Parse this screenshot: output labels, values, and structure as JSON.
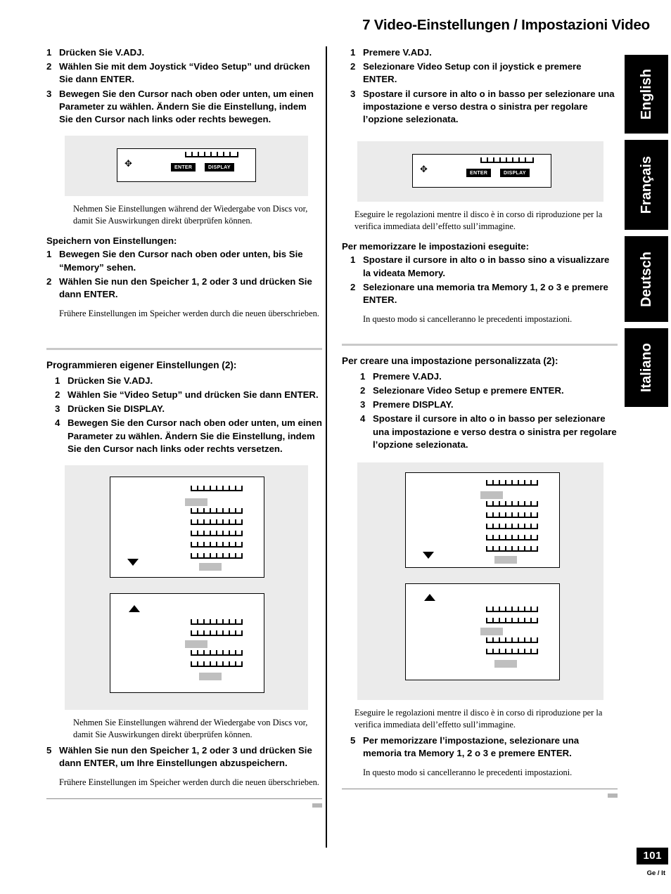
{
  "header": {
    "title": "7 Video-Einstellungen / Impostazioni Video"
  },
  "language_tabs": [
    {
      "label": "English"
    },
    {
      "label": "Français"
    },
    {
      "label": "Deutsch"
    },
    {
      "label": "Italiano"
    }
  ],
  "left_column": {
    "steps_top": [
      {
        "num": "1",
        "text": "Drücken Sie V.ADJ."
      },
      {
        "num": "2",
        "text": "Wählen Sie mit dem Joystick “Video Setup” und drücken Sie dann ENTER."
      },
      {
        "num": "3",
        "text": "Bewegen Sie den Cursor nach oben oder unten, um einen Parameter zu wählen. Ändern Sie die Einstellung, indem Sie den Cursor nach links oder rechts bewegen."
      }
    ],
    "figure_remote": {
      "dpad": "✥",
      "enter_label": "ENTER",
      "display_label": "DISPLAY"
    },
    "note_1": "Nehmen Sie Einstellungen während der Wiedergabe von Discs vor, damit Sie Auswirkungen direkt überprüfen können.",
    "subhead_memory": "Speichern von Einstellungen:",
    "steps_memory": [
      {
        "num": "1",
        "text": "Bewegen Sie den Cursor nach oben oder unten, bis Sie “Memory” sehen."
      },
      {
        "num": "2",
        "text": "Wählen Sie nun den Speicher 1, 2 oder 3 und drücken Sie dann ENTER."
      }
    ],
    "note_2": "Frühere Einstellungen im Speicher werden durch die neuen überschrieben.",
    "section_head": "Programmieren eigener Einstellungen (2):",
    "steps_custom": [
      {
        "num": "1",
        "text": "Drücken Sie V.ADJ."
      },
      {
        "num": "2",
        "text": "Wählen Sie “Video Setup” und drücken Sie dann ENTER."
      },
      {
        "num": "3",
        "text": "Drücken Sie DISPLAY."
      },
      {
        "num": "4",
        "text": "Bewegen Sie den Cursor nach oben oder unten, um einen Parameter zu wählen. Ändern Sie die Einstellung, indem Sie den Cursor nach links oder rechts versetzen."
      }
    ],
    "note_3": "Nehmen Sie Einstellungen während der Wiedergabe von Discs vor, damit Sie Auswirkungen direkt überprüfen können.",
    "step_5": {
      "num": "5",
      "text": "Wählen Sie nun den Speicher 1, 2 oder 3 und drücken Sie dann ENTER, um Ihre Einstellungen abzuspeichern."
    },
    "note_4": "Frühere Einstellungen im Speicher werden durch die neuen überschrieben."
  },
  "right_column": {
    "steps_top": [
      {
        "num": "1",
        "text": "Premere V.ADJ."
      },
      {
        "num": "2",
        "text": "Selezionare Video Setup con il joystick e premere ENTER."
      },
      {
        "num": "3",
        "text": "Spostare il cursore in alto o in basso per selezionare una impostazione e verso destra o sinistra per regolare l’opzione selezionata."
      }
    ],
    "figure_remote": {
      "dpad": "✥",
      "enter_label": "ENTER",
      "display_label": "DISPLAY"
    },
    "note_1": "Eseguire le regolazioni mentre il disco è in corso di riproduzione per la verifica immediata dell’effetto sull’immagine.",
    "subhead_memory": "Per memorizzare le impostazioni eseguite:",
    "steps_memory": [
      {
        "num": "1",
        "text": "Spostare il cursore in alto o in basso sino a visualizzare la videata Memory."
      },
      {
        "num": "2",
        "text": "Selezionare una memoria tra Memory 1, 2 o 3 e premere ENTER."
      }
    ],
    "note_2": "In questo modo si cancelleranno le precedenti impostazioni.",
    "section_head": "Per creare una impostazione personalizzata (2):",
    "steps_custom": [
      {
        "num": "1",
        "text": "Premere V.ADJ."
      },
      {
        "num": "2",
        "text": "Selezionare Video Setup e premere ENTER."
      },
      {
        "num": "3",
        "text": "Premere DISPLAY."
      },
      {
        "num": "4",
        "text": "Spostare il cursore in alto o in basso per selezionare una impostazione e verso destra o sinistra per regolare l’opzione selezionata."
      }
    ],
    "note_3": "Eseguire le regolazioni mentre il disco è in corso di riproduzione per la verifica immediata dell’effetto sull’immagine.",
    "step_5": {
      "num": "5",
      "text": "Per memorizzare l’impostazione, selezionare una memoria tra Memory 1, 2 o 3 e premere ENTER."
    },
    "note_4": "In questo modo si cancelleranno le precedenti impostazioni."
  },
  "footer": {
    "page_number": "101",
    "language_code": "Ge / It"
  }
}
